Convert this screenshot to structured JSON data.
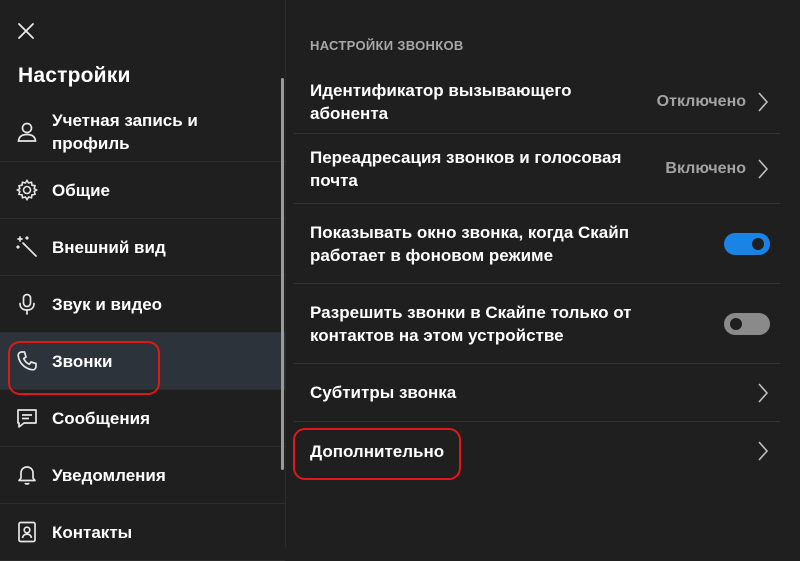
{
  "sidebar": {
    "title": "Настройки",
    "close_icon": "close-icon",
    "items": [
      {
        "label": "Учетная запись и\nпрофиль",
        "icon": "person-icon"
      },
      {
        "label": "Общие",
        "icon": "gear-icon"
      },
      {
        "label": "Внешний вид",
        "icon": "magic-wand-icon"
      },
      {
        "label": "Звук и видео",
        "icon": "microphone-icon"
      },
      {
        "label": "Звонки",
        "icon": "phone-icon",
        "active": true
      },
      {
        "label": "Сообщения",
        "icon": "message-icon"
      },
      {
        "label": "Уведомления",
        "icon": "bell-icon"
      },
      {
        "label": "Контакты",
        "icon": "contacts-icon"
      }
    ]
  },
  "main": {
    "section_title": "НАСТРОЙКИ ЗВОНКОВ",
    "rows": [
      {
        "label": "Идентификатор вызывающего\nабонента",
        "status": "Отключено",
        "control": "chevron"
      },
      {
        "label": "Переадресация звонков и голосовая\nпочта",
        "status": "Включено",
        "control": "chevron"
      },
      {
        "label": "Показывать окно звонка, когда Скайп\nработает в фоновом режиме",
        "control": "toggle",
        "value": true
      },
      {
        "label": "Разрешить звонки в Скайпе только от\nконтактов на этом устройстве",
        "control": "toggle",
        "value": false
      },
      {
        "label": "Субтитры звонка",
        "control": "chevron"
      },
      {
        "label": "Дополнительно",
        "control": "chevron"
      }
    ]
  },
  "colors": {
    "background": "#1f1f1f",
    "active_item": "#2d333b",
    "toggle_on": "#1a84e6",
    "highlight": "#e01818"
  }
}
